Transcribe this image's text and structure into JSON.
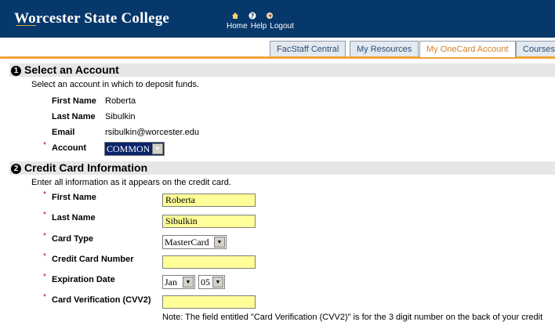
{
  "header": {
    "logo_text": "Worcester State College",
    "links": [
      "Home",
      "Help",
      "Logout"
    ]
  },
  "tabs": [
    {
      "label": "FacStaff Central",
      "active": false
    },
    {
      "label": "My Resources",
      "active": false
    },
    {
      "label": "My OneCard Account",
      "active": true
    },
    {
      "label": "Courses",
      "active": false
    }
  ],
  "section1": {
    "number": "1",
    "title": "Select an Account",
    "instruction": "Select an account in which to deposit funds.",
    "first_name_label": "First Name",
    "first_name_value": "Roberta",
    "last_name_label": "Last Name",
    "last_name_value": "Sibulkin",
    "email_label": "Email",
    "email_value": "rsibulkin@worcester.edu",
    "account_label": "Account",
    "account_value": "COMMON"
  },
  "section2": {
    "number": "2",
    "title": "Credit Card Information",
    "instruction": "Enter all information as it appears on the credit card.",
    "first_name_label": "First Name",
    "first_name_value": "Roberta",
    "last_name_label": "Last Name",
    "last_name_value": "Sibulkin",
    "card_type_label": "Card Type",
    "card_type_value": "MasterCard",
    "card_number_label": "Credit Card Number",
    "card_number_value": "",
    "expiration_label": "Expiration Date",
    "exp_month": "Jan",
    "exp_year": "05",
    "cvv2_label": "Card Verification (CVV2)",
    "cvv2_value": "",
    "note": "Note: The field entitled \"Card Verification (CVV2)\" is for the 3 digit number on the back of your credit"
  },
  "required_mark": "*",
  "colors": {
    "banner": "#07386b",
    "tab_accent": "#f0a33a",
    "field_highlight": "#ffff99",
    "required": "#cc0000"
  }
}
